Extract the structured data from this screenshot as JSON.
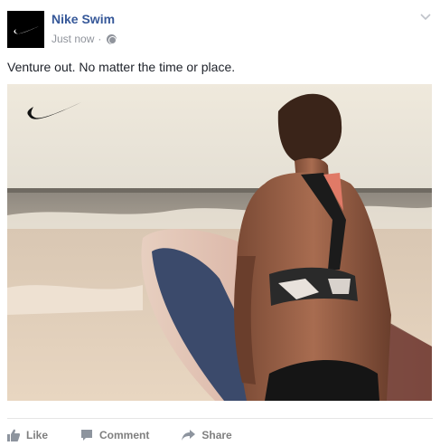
{
  "post": {
    "page_name": "Nike Swim",
    "timestamp": "Just now",
    "separator": "·",
    "privacy_icon": "globe-icon",
    "menu_icon": "chevron-down-icon",
    "message": "Venture out. No matter the time or place.",
    "image_icon": "nike-swoosh-icon"
  },
  "actions": {
    "like_label": "Like",
    "comment_label": "Comment",
    "share_label": "Share"
  },
  "colors": {
    "page_name": "#365899",
    "meta_text": "#90949c",
    "action_text": "#7f7f7f"
  }
}
